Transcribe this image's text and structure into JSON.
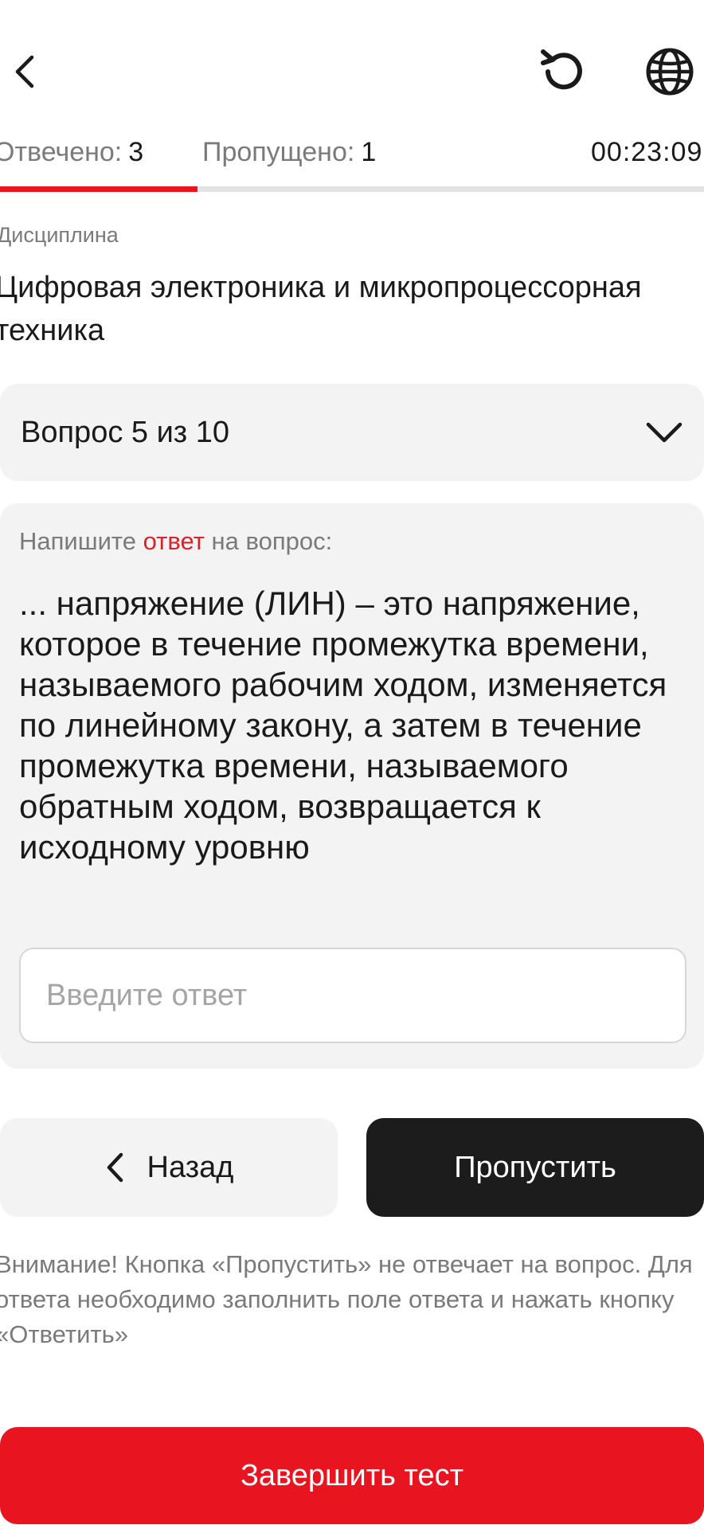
{
  "header": {
    "back_icon": "chevron-left-icon",
    "restart_icon": "restart-icon",
    "language_icon": "globe-icon"
  },
  "stats": {
    "answered_label": "Отвечено:",
    "answered_value": "3",
    "skipped_label": "Пропущено:",
    "skipped_value": "1",
    "timer": "00:23:09"
  },
  "progress": {
    "fraction": 0.28,
    "fill_color": "#e8141f",
    "track_color": "#e3e3e6"
  },
  "discipline": {
    "label": "Дисциплина",
    "name": "Цифровая электроника и микропроцессорная техника"
  },
  "question_selector": {
    "label": "Вопрос 5 из 10",
    "icon": "chevron-down-icon"
  },
  "question_card": {
    "prompt_before": "Напишите ",
    "prompt_accent": "ответ",
    "prompt_after": " на вопрос:",
    "question_text": "... напряжение (ЛИН) – это напряжение, которое в течение промежутка времени, называемого рабочим ходом, изменяется по линейному закону, а затем в течение промежутка времени, называемого обратным ходом, возвращается к исходному уровню",
    "input_placeholder": "Введите ответ",
    "input_value": ""
  },
  "actions": {
    "back_label": "Назад",
    "skip_label": "Пропустить"
  },
  "warning_text": "Внимание! Кнопка «Пропустить» не отвечает на вопрос. Для ответа необходимо заполнить поле ответа и нажать кнопку «Ответить»",
  "finish_label": "Завершить тест",
  "colors": {
    "accent": "#e8141f",
    "dark": "#1c1c1c",
    "muted": "#7a7a7a",
    "card_bg": "#f3f3f3"
  }
}
